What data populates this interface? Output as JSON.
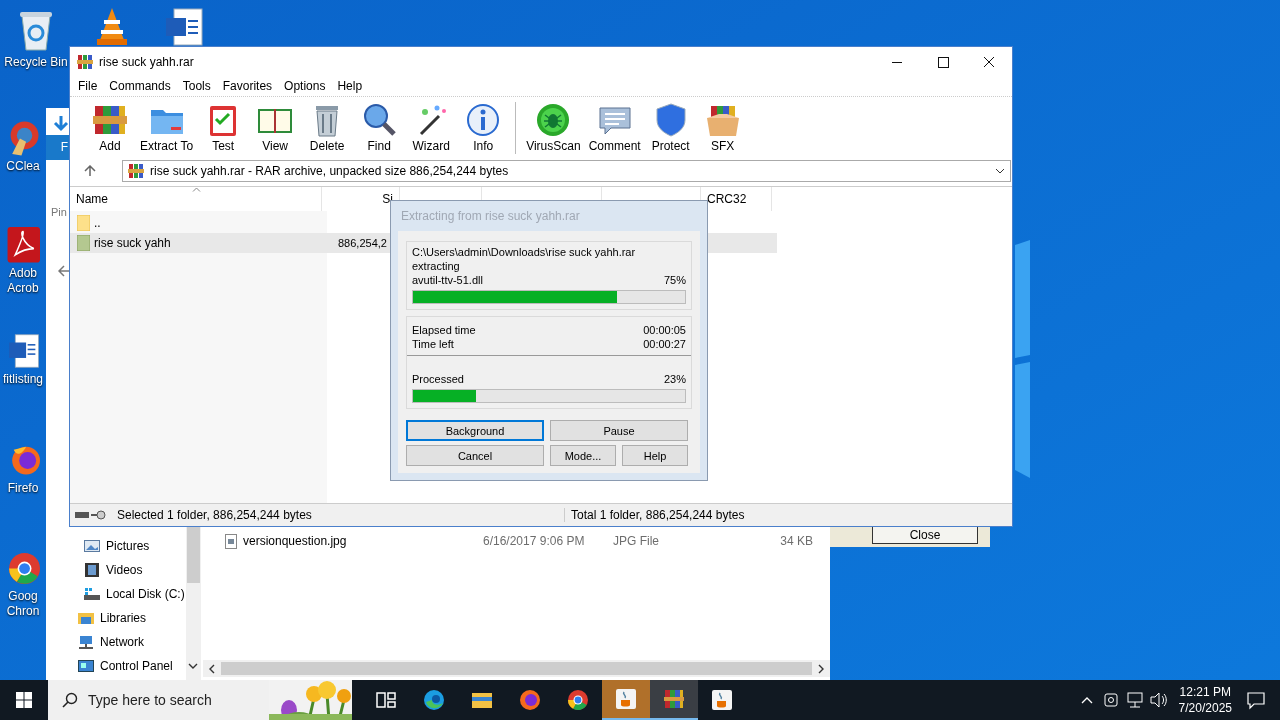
{
  "desktop_icons": [
    {
      "label": "Recycle Bin",
      "kind": "recycle"
    },
    {
      "label": "CClea",
      "kind": "ccleaner"
    },
    {
      "label": "Adob Acrob",
      "kind": "pdf"
    },
    {
      "label": "fitlisting",
      "kind": "doc"
    },
    {
      "label": "Firefo",
      "kind": "firefox"
    },
    {
      "label": "Goog Chron",
      "kind": "chrome"
    }
  ],
  "explorer_window": {
    "ribbon_tab": "F",
    "pin_label": "Pin",
    "nav_items": [
      {
        "label": "Pictures",
        "kind": "pictures"
      },
      {
        "label": "Videos",
        "kind": "videos"
      },
      {
        "label": "Local Disk (C:)",
        "kind": "disk"
      },
      {
        "label": "Libraries",
        "kind": "libraries"
      },
      {
        "label": "Network",
        "kind": "network"
      },
      {
        "label": "Control Panel",
        "kind": "controlpanel"
      }
    ],
    "files": [
      {
        "name": "versionquestion.jpg",
        "date": "6/16/2017 9:06 PM",
        "type": "JPG File",
        "size": "34 KB"
      }
    ]
  },
  "background_dialog": {
    "button": "Close"
  },
  "winrar": {
    "title": "rise suck yahh.rar",
    "menu": [
      "File",
      "Commands",
      "Tools",
      "Favorites",
      "Options",
      "Help"
    ],
    "toolbar": [
      {
        "label": "Add",
        "kind": "add"
      },
      {
        "label": "Extract To",
        "kind": "extract"
      },
      {
        "label": "Test",
        "kind": "test"
      },
      {
        "label": "View",
        "kind": "view"
      },
      {
        "label": "Delete",
        "kind": "delete"
      },
      {
        "label": "Find",
        "kind": "find"
      },
      {
        "label": "Wizard",
        "kind": "wizard"
      },
      {
        "label": "Info",
        "kind": "info"
      },
      {
        "label": "VirusScan",
        "kind": "virus"
      },
      {
        "label": "Comment",
        "kind": "comment"
      },
      {
        "label": "Protect",
        "kind": "protect"
      },
      {
        "label": "SFX",
        "kind": "sfx"
      }
    ],
    "address": "rise suck yahh.rar - RAR archive, unpacked size 886,254,244 bytes",
    "columns": [
      "Name",
      "Si",
      "CRC32"
    ],
    "rows": [
      {
        "name": "..",
        "kind": "parent",
        "selected": false
      },
      {
        "name": "rise suck yahh",
        "size": "886,254,2",
        "kind": "folder",
        "selected": true
      }
    ],
    "status_left": "Selected 1 folder, 886,254,244 bytes",
    "status_right": "Total 1 folder, 886,254,244 bytes"
  },
  "extract_dialog": {
    "title": "Extracting from rise suck yahh.rar",
    "archive_path": "C:\\Users\\admin\\Downloads\\rise suck yahh.rar",
    "action": "extracting",
    "file": "avutil-ttv-51.dll",
    "file_percent": "75%",
    "file_progress": {
      "level": 0.75
    },
    "elapsed_label": "Elapsed time",
    "elapsed": "00:00:05",
    "left_label": "Time left",
    "left": "00:00:27",
    "processed_label": "Processed",
    "processed_percent": "23%",
    "processed_progress": {
      "level": 0.23
    },
    "buttons": [
      {
        "label": "Background",
        "focused": true
      },
      {
        "label": "Pause",
        "focused": false
      },
      {
        "label": "Cancel",
        "focused": false
      },
      {
        "label": "Mode...",
        "focused": false
      },
      {
        "label": "Help",
        "focused": false
      }
    ]
  },
  "taskbar": {
    "search_placeholder": "Type here to search",
    "apps": [
      {
        "kind": "taskview",
        "active": false
      },
      {
        "kind": "edge",
        "active": false
      },
      {
        "kind": "explorer",
        "active": false
      },
      {
        "kind": "firefox",
        "active": false
      },
      {
        "kind": "chrome",
        "active": false
      },
      {
        "kind": "java",
        "active": true
      },
      {
        "kind": "winrar",
        "active": true
      },
      {
        "kind": "java",
        "active": false
      }
    ],
    "time": "12:21 PM",
    "date": "7/20/2025"
  }
}
